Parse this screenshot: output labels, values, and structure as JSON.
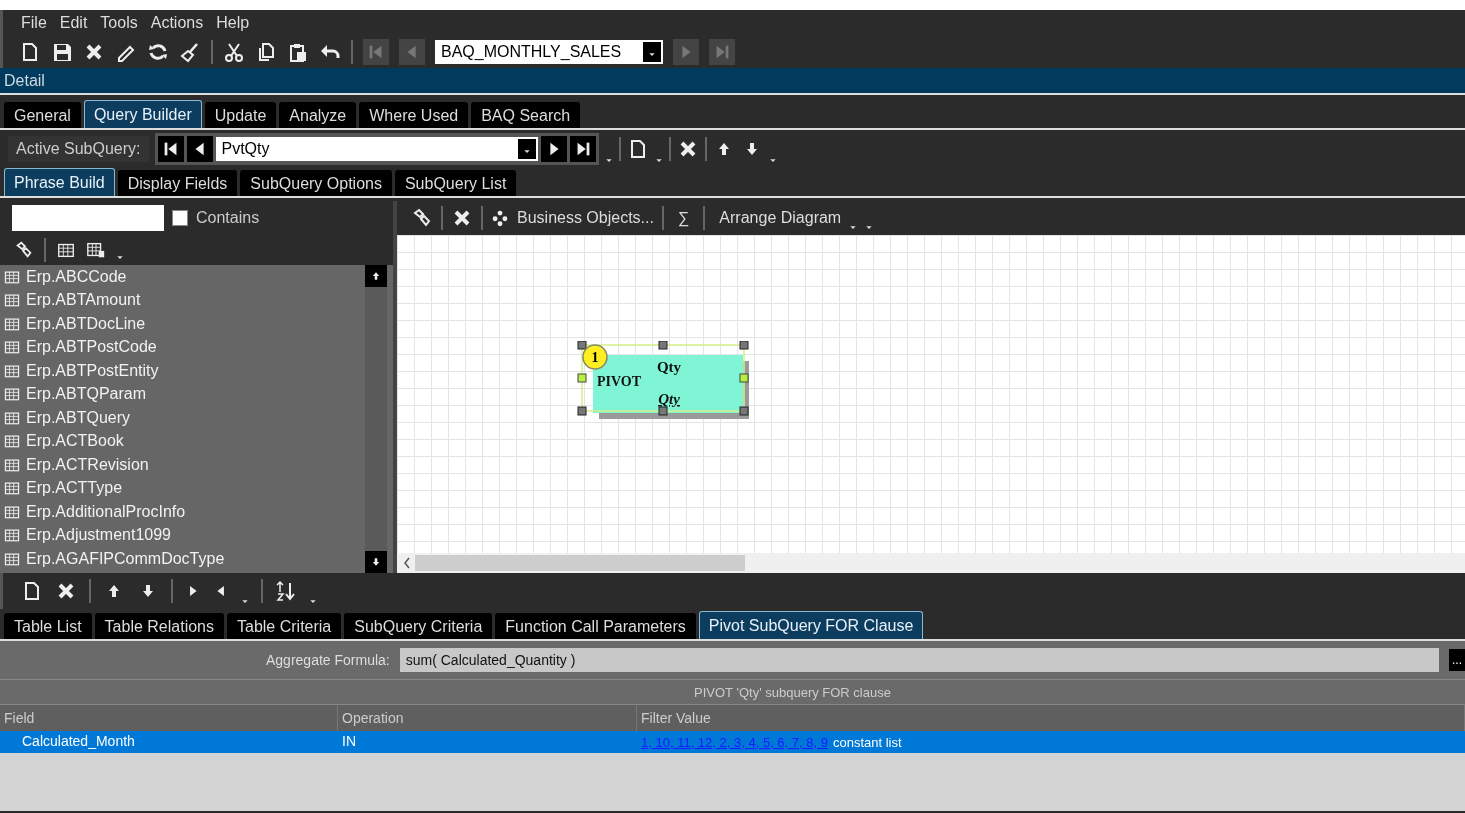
{
  "menu": [
    "File",
    "Edit",
    "Tools",
    "Actions",
    "Help"
  ],
  "record_selector": {
    "value": "BAQ_MONTHLY_SALES"
  },
  "section_title": "Detail",
  "tabs": [
    {
      "label": "General",
      "selected": false
    },
    {
      "label": "Query Builder",
      "selected": true
    },
    {
      "label": "Update",
      "selected": false
    },
    {
      "label": "Analyze",
      "selected": false
    },
    {
      "label": "Where Used",
      "selected": false
    },
    {
      "label": "BAQ Search",
      "selected": false
    }
  ],
  "active_subquery": {
    "label": "Active SubQuery:",
    "value": "PvtQty"
  },
  "subquery_tabs": [
    {
      "label": "Phrase Build",
      "selected": true
    },
    {
      "label": "Display Fields",
      "selected": false
    },
    {
      "label": "SubQuery Options",
      "selected": false
    },
    {
      "label": "SubQuery List",
      "selected": false
    }
  ],
  "table_search": {
    "contains_label": "Contains",
    "checked": false
  },
  "tables": [
    "Erp.ABCCode",
    "Erp.ABTAmount",
    "Erp.ABTDocLine",
    "Erp.ABTPostCode",
    "Erp.ABTPostEntity",
    "Erp.ABTQParam",
    "Erp.ABTQuery",
    "Erp.ACTBook",
    "Erp.ACTRevision",
    "Erp.ACTType",
    "Erp.AdditionalProcInfo",
    "Erp.Adjustment1099",
    "Erp.AGAFIPCommDocType"
  ],
  "diagram_toolbar": {
    "business_objects": "Business Objects...",
    "sum": "∑",
    "arrange": "Arrange Diagram"
  },
  "diagram_node": {
    "badge": "1",
    "type": "PIVOT",
    "title": "Qty",
    "field": "Qty"
  },
  "bottom_tabs": [
    {
      "label": "Table List",
      "selected": false
    },
    {
      "label": "Table Relations",
      "selected": false
    },
    {
      "label": "Table Criteria",
      "selected": false
    },
    {
      "label": "SubQuery Criteria",
      "selected": false
    },
    {
      "label": "Function Call Parameters",
      "selected": false
    },
    {
      "label": "Pivot SubQuery FOR Clause",
      "selected": true
    }
  ],
  "aggregate": {
    "label": "Aggregate Formula:",
    "value": "sum( Calculated_Quantity )",
    "browse": "..."
  },
  "for_clause": {
    "caption": "PIVOT 'Qty' subquery FOR clause",
    "columns": [
      "Field",
      "Operation",
      "Filter Value"
    ],
    "rows": [
      {
        "field": "Calculated_Month",
        "operation": "IN",
        "filter_link": "1, 10, 11, 12, 2, 3, 4, 5, 6, 7, 8, 9",
        "filter_note": "constant list",
        "selected": true
      }
    ]
  }
}
